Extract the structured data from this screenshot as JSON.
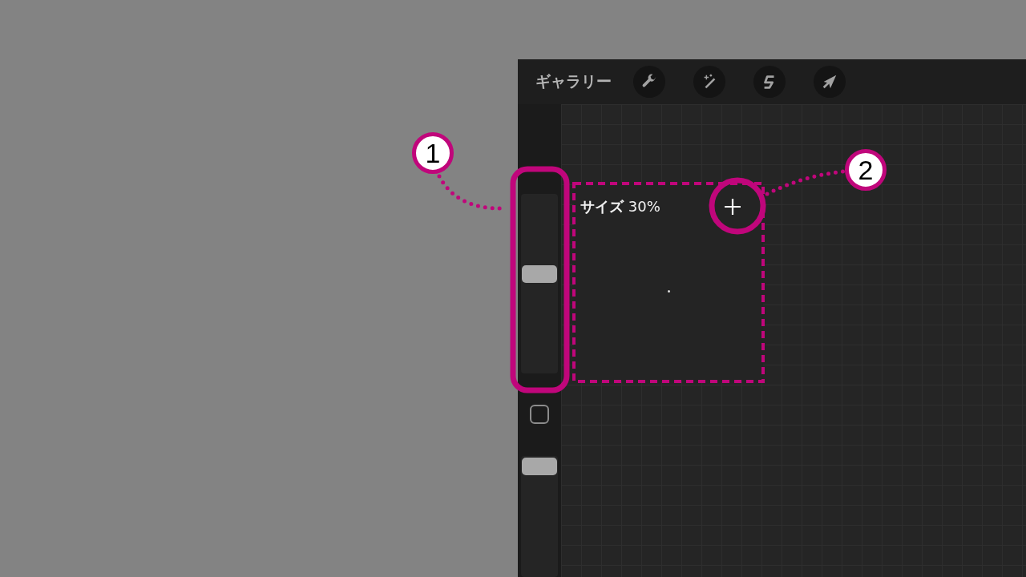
{
  "toolbar": {
    "gallery_label": "ギャラリー"
  },
  "sidebar": {
    "size_slider": {
      "level": 0.56
    },
    "opacity_slider": {
      "level": 1
    }
  },
  "size_popup": {
    "label": "サイズ",
    "value": "30%"
  },
  "annotations": [
    {
      "label": "1"
    },
    {
      "label": "2"
    }
  ]
}
